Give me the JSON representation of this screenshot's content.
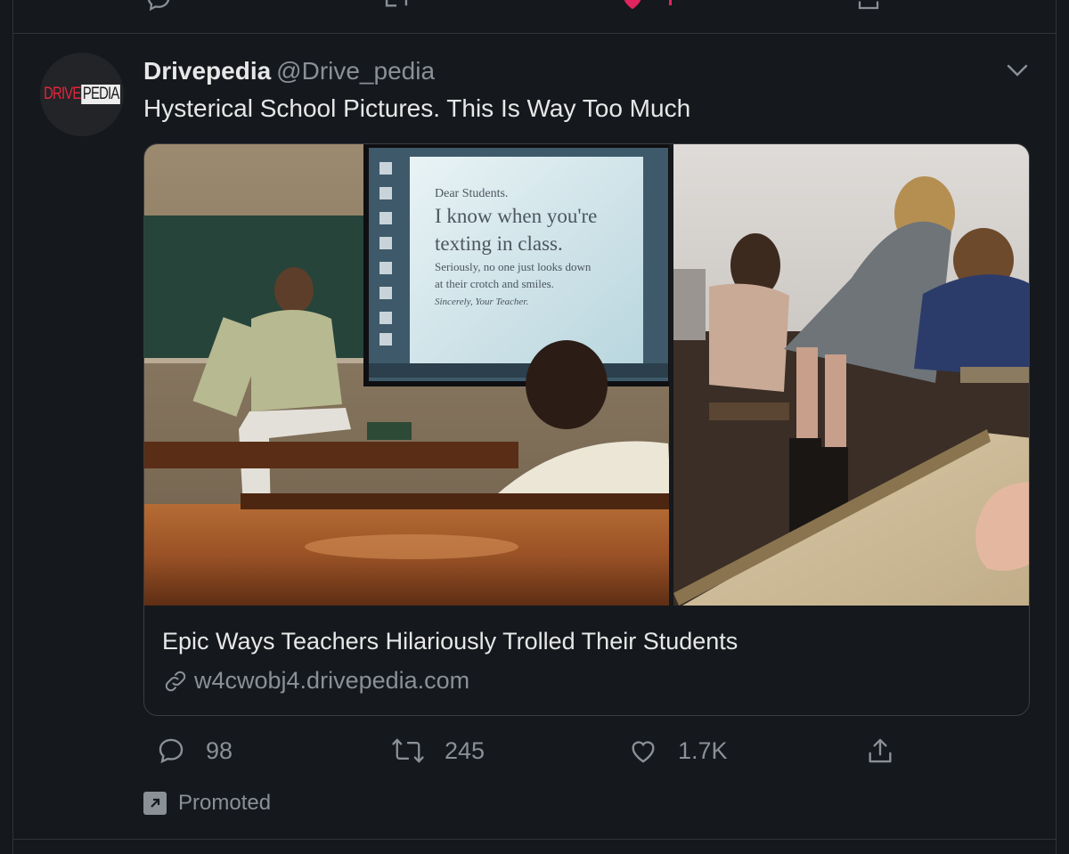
{
  "tweet": {
    "author_name": "Drivepedia",
    "author_handle": "@Drive_pedia",
    "avatar_logo": {
      "part1": "DRIVE",
      "part2": "PEDIA"
    },
    "text": "Hysterical School Pictures. This Is Way Too Much",
    "card": {
      "title": "Epic Ways Teachers Hilariously Trolled Their Students",
      "link": "w4cwobj4.drivepedia.com",
      "screen_text": {
        "line1": "Dear Students.",
        "line2": "I know when you're",
        "line3": "texting in class.",
        "line4": "Seriously, no one just looks down",
        "line5": "at their crotch and smiles.",
        "line6": "Sincerely, Your Teacher."
      }
    },
    "actions": {
      "replies": "98",
      "retweets": "245",
      "likes": "1.7K"
    },
    "promoted_label": "Promoted"
  },
  "colors": {
    "background": "#15181c",
    "text_primary": "#e7e7e7",
    "text_secondary": "#8a9096",
    "border": "#2f3336",
    "like_active": "#e0245e"
  },
  "icons": [
    "reply-icon",
    "retweet-icon",
    "like-icon",
    "share-icon",
    "chevron-down-icon",
    "link-icon",
    "promoted-arrow-icon"
  ]
}
